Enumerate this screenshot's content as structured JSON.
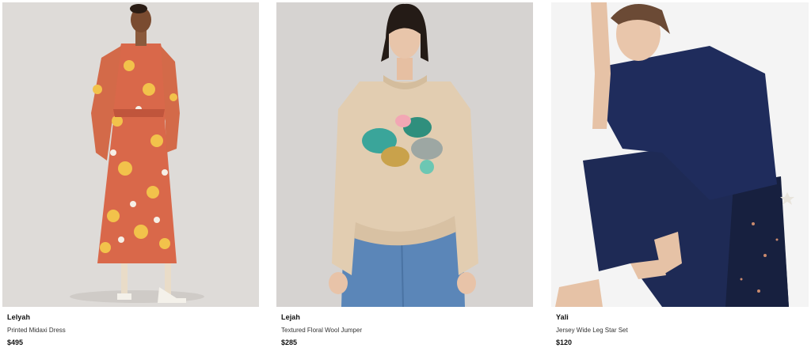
{
  "products": [
    {
      "name": "Lelyah",
      "description": "Printed Midaxi Dress",
      "price": "$495"
    },
    {
      "name": "Lejah",
      "description": "Textured Floral Wool Jumper",
      "price": "$285"
    },
    {
      "name": "Yali",
      "description": "Jersey Wide Leg Star Set",
      "price": "$120"
    }
  ],
  "colors": {
    "dress_orange": "#d9684a",
    "jumper_cream": "#e2cdb1",
    "jeans_blue": "#5b86b8",
    "navy_set": "#1e2a55",
    "studio_gray": "#dedbd8"
  }
}
